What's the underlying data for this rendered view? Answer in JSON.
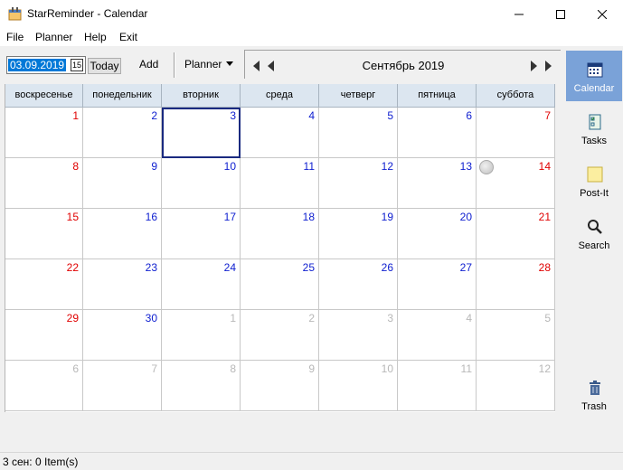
{
  "window": {
    "title": "StarReminder - Calendar"
  },
  "menu": [
    "File",
    "Planner",
    "Help",
    "Exit"
  ],
  "toolbar": {
    "date_value": "03.09.2019",
    "today_label": "Today",
    "add_label": "Add",
    "view_selected": "Planner"
  },
  "calendar": {
    "month_title": "Сентябрь 2019",
    "day_names": [
      "воскресенье",
      "понедельник",
      "вторник",
      "среда",
      "четверг",
      "пятница",
      "суббота"
    ],
    "weeks": [
      [
        "1",
        "2",
        "3",
        "4",
        "5",
        "6",
        "7"
      ],
      [
        "8",
        "9",
        "10",
        "11",
        "12",
        "13",
        "14"
      ],
      [
        "15",
        "16",
        "17",
        "18",
        "19",
        "20",
        "21"
      ],
      [
        "22",
        "23",
        "24",
        "25",
        "26",
        "27",
        "28"
      ],
      [
        "29",
        "30",
        "1",
        "2",
        "3",
        "4",
        "5"
      ],
      [
        "6",
        "7",
        "8",
        "9",
        "10",
        "11",
        "12"
      ]
    ],
    "selected_date": "3"
  },
  "sidebar": [
    {
      "label": "Calendar",
      "icon": "calendar-icon"
    },
    {
      "label": "Tasks",
      "icon": "tasks-icon"
    },
    {
      "label": "Post-It",
      "icon": "postit-icon"
    },
    {
      "label": "Search",
      "icon": "search-icon"
    },
    {
      "label": "Trash",
      "icon": "trash-icon"
    }
  ],
  "status": {
    "text": "3 сен: 0 Item(s)"
  }
}
